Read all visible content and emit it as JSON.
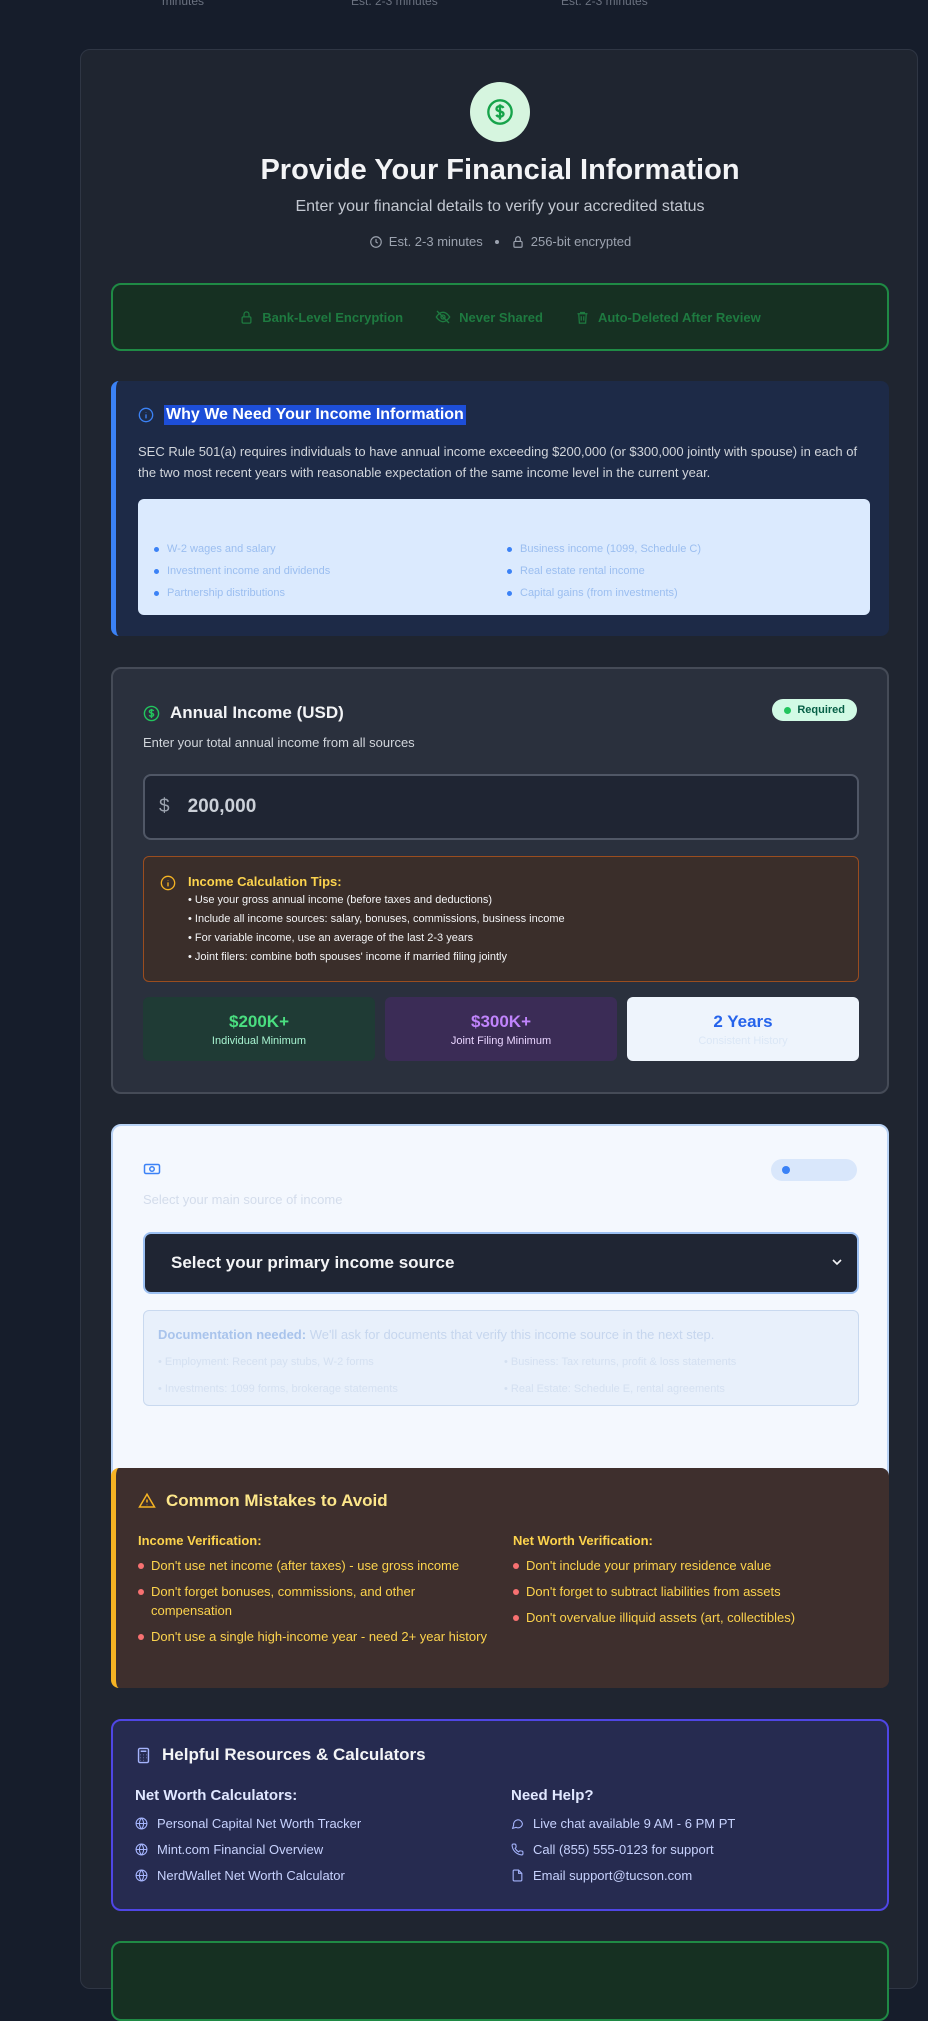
{
  "top_cut": {
    "c1": "minutes",
    "c2": "Est. 2-3 minutes",
    "c3": "Est. 2-3 minutes"
  },
  "header": {
    "icon": "dollar-icon",
    "title": "Provide Your Financial Information",
    "subtitle": "Enter your financial details to verify your accredited status",
    "time_estimate": "Est. 2-3 minutes",
    "encryption": "256-bit encrypted"
  },
  "security_bar": {
    "items": [
      "Bank-Level Encryption",
      "Never Shared",
      "Auto-Deleted After Review"
    ]
  },
  "why": {
    "title": "Why We Need Your Income Information",
    "body": "SEC Rule 501(a) requires individuals to have annual income exceeding $200,000 (or $300,000 jointly with spouse) in each of the two most recent years with reasonable expectation of the same income level in the current year.",
    "left_items": [
      "W-2 wages and salary",
      "Investment income and dividends",
      "Partnership distributions"
    ],
    "right_items": [
      "Business income (1099, Schedule C)",
      "Real estate rental income",
      "Capital gains (from investments)"
    ]
  },
  "income": {
    "title": "Annual Income (USD)",
    "required_badge": "Required",
    "subtitle": "Enter your total annual income from all sources",
    "currency_symbol": "$",
    "value": "200,000",
    "tips_title": "Income Calculation Tips:",
    "tips": [
      "Use your gross annual income (before taxes and deductions)",
      "Include all income sources: salary, bonuses, commissions, business income",
      "For variable income, use an average of the last 2-3 years",
      "Joint filers: combine both spouses' income if married filing jointly"
    ],
    "stats": [
      {
        "value": "$200K+",
        "label": "Individual Minimum"
      },
      {
        "value": "$300K+",
        "label": "Joint Filing Minimum"
      },
      {
        "value": "2 Years",
        "label": "Consistent History"
      }
    ]
  },
  "source": {
    "subtitle": "Select your main source of income",
    "select_value": "Select your primary income source",
    "doc_head_bold": "Documentation needed:",
    "doc_head_rest": " We'll ask for documents that verify this income source in the next step.",
    "doc_left": [
      "• Employment: Recent pay stubs, W-2 forms",
      "• Investments: 1099 forms, brokerage statements"
    ],
    "doc_right": [
      "• Business: Tax returns, profit & loss statements",
      "• Real Estate: Schedule E, rental agreements"
    ]
  },
  "mistakes": {
    "title": "Common Mistakes to Avoid",
    "income_head": "Income Verification:",
    "income_items": [
      "Don't use net income (after taxes) - use gross income",
      "Don't forget bonuses, commissions, and other compensation",
      "Don't use a single high-income year - need 2+ year history"
    ],
    "networth_head": "Net Worth Verification:",
    "networth_items": [
      "Don't include your primary residence value",
      "Don't forget to subtract liabilities from assets",
      "Don't overvalue illiquid assets (art, collectibles)"
    ]
  },
  "resources": {
    "title": "Helpful Resources & Calculators",
    "calc_head": "Net Worth Calculators:",
    "calc_items": [
      "Personal Capital Net Worth Tracker",
      "Mint.com Financial Overview",
      "NerdWallet Net Worth Calculator"
    ],
    "help_head": "Need Help?",
    "help_items": [
      "Live chat available 9 AM - 6 PM PT",
      "Call (855) 555-0123 for support",
      "Email support@tucson.com"
    ]
  },
  "colors": {
    "accent_green": "#22c55e",
    "accent_blue": "#3b82f6",
    "warning": "#f5b323",
    "indigo": "#4f46e5"
  }
}
